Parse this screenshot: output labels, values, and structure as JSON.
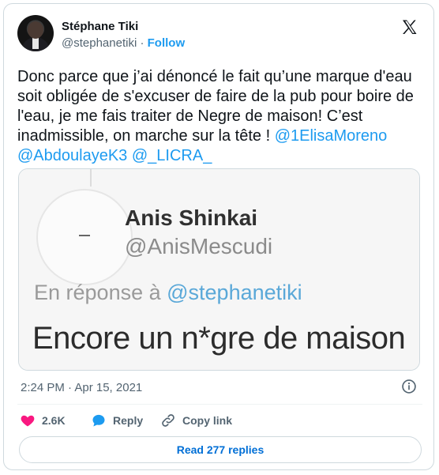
{
  "author": {
    "name": "Stéphane Tiki",
    "handle": "@stephanetiki",
    "separator": "·",
    "follow_label": "Follow"
  },
  "tweet": {
    "text": "Donc parce que j’ai dénoncé le fait qu’une marque d'eau soit obligée de s'excuser de faire de la pub pour boire de l'eau, je me fais traiter de Negre de maison! C’est inadmissible, on marche sur la tête ! ",
    "mentions": [
      "@1ElisaMoreno",
      "@AbdoulayeK3",
      "@_LICRA_"
    ]
  },
  "quoted_image": {
    "name": "Anis Shinkai",
    "handle": "@AnisMescudi",
    "reply_prefix": "En réponse à ",
    "reply_mention": "@stephanetiki",
    "body": "Encore un n*gre de maison"
  },
  "timestamp": "2:24 PM · Apr 15, 2021",
  "actions": {
    "likes": "2.6K",
    "reply_label": "Reply",
    "copy_label": "Copy link"
  },
  "replies_button": "Read 277 replies",
  "colors": {
    "accent": "#1d9bf0",
    "like": "#f91880",
    "text": "#0f1419",
    "muted": "#536471",
    "border": "#cfd9de"
  },
  "icons": [
    "x-logo-icon",
    "info-icon",
    "heart-icon",
    "reply-bubble-icon",
    "link-icon"
  ]
}
